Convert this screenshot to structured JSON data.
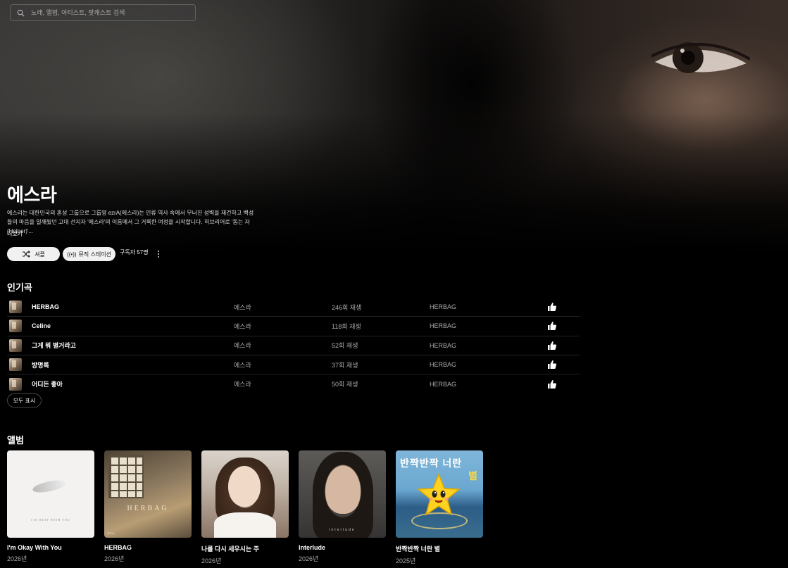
{
  "search": {
    "placeholder": "노래, 앨범, 아티스트, 팟캐스트 검색"
  },
  "artist": {
    "name": "에스라",
    "description": "에스라는 대한민국의 혼성 그룹으로 그룹명 ezrA(에스라)는 인류 역사 속에서 무너진 성벽을 재건하고 백성들의 마음을 일깨웠던 고대 선지자 '에스라'의 이름에서 그 거룩한 여정을 시작합니다. 히브리어로 '돕는 자(Helper)'...",
    "more_label": "더보기",
    "shuffle_label": "셔플",
    "radio_label": "뮤직 스테이션",
    "subscribers": "구독자 57명"
  },
  "popular": {
    "title": "인기곡",
    "show_all": "모두 표시",
    "songs": [
      {
        "title": "HERBAG",
        "artist": "에스라",
        "plays": "246회 재생",
        "album": "HERBAG"
      },
      {
        "title": "Celine",
        "artist": "에스라",
        "plays": "118회 재생",
        "album": "HERBAG"
      },
      {
        "title": "그게 뭐 별거라고",
        "artist": "에스라",
        "plays": "52회 재생",
        "album": "HERBAG"
      },
      {
        "title": "방명록",
        "artist": "에스라",
        "plays": "37회 재생",
        "album": "HERBAG"
      },
      {
        "title": "어디든 좋아",
        "artist": "에스라",
        "plays": "50회 재생",
        "album": "HERBAG"
      }
    ]
  },
  "albums": {
    "title": "앨범",
    "items": [
      {
        "title": "I'm Okay With You",
        "year": "2026년",
        "cover_text": "I'M OKAY WITH YOU"
      },
      {
        "title": "HERBAG",
        "year": "2026년",
        "cover_text": "HERBAG",
        "cover_sub": "EZRA"
      },
      {
        "title": "나를 다시 세우시는 주",
        "year": "2026년"
      },
      {
        "title": "Interlude",
        "year": "2026년",
        "cover_text": "interlude"
      },
      {
        "title": "반짝반짝 너란 별",
        "year": "2025년",
        "cover_text": "반짝반짝 너란",
        "cover_text2": "별"
      }
    ]
  },
  "colors": {
    "background": "#000000",
    "button_bg": "#f1f1f1",
    "muted_text": "#aaaaaa"
  },
  "icons": [
    "search-icon",
    "shuffle-icon",
    "radio-icon",
    "more-vert-icon",
    "thumb-up-icon"
  ]
}
